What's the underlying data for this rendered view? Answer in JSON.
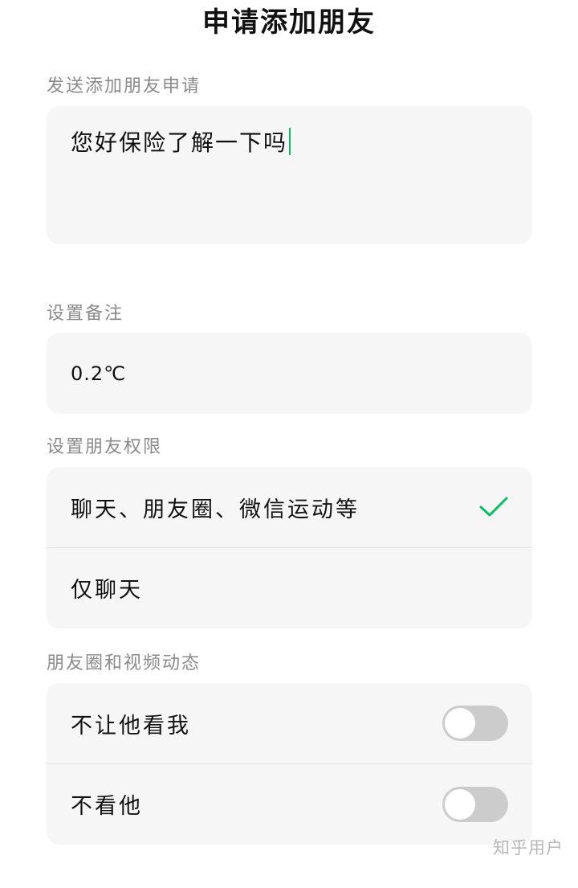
{
  "header": {
    "title": "申请添加朋友"
  },
  "request": {
    "label": "发送添加朋友申请",
    "message": "您好保险了解一下吗"
  },
  "remark": {
    "label": "设置备注",
    "value": "0.2℃"
  },
  "permissions": {
    "label": "设置朋友权限",
    "options": [
      {
        "label": "聊天、朋友圈、微信运动等",
        "selected": true
      },
      {
        "label": "仅聊天",
        "selected": false
      }
    ]
  },
  "moments": {
    "label": "朋友圈和视频动态",
    "toggles": [
      {
        "label": "不让他看我",
        "on": false
      },
      {
        "label": "不看他",
        "on": false
      }
    ]
  },
  "watermark": "知乎用户",
  "colors": {
    "accent": "#07c160",
    "card_bg": "#f6f6f6",
    "toggle_off": "#cccccc"
  }
}
